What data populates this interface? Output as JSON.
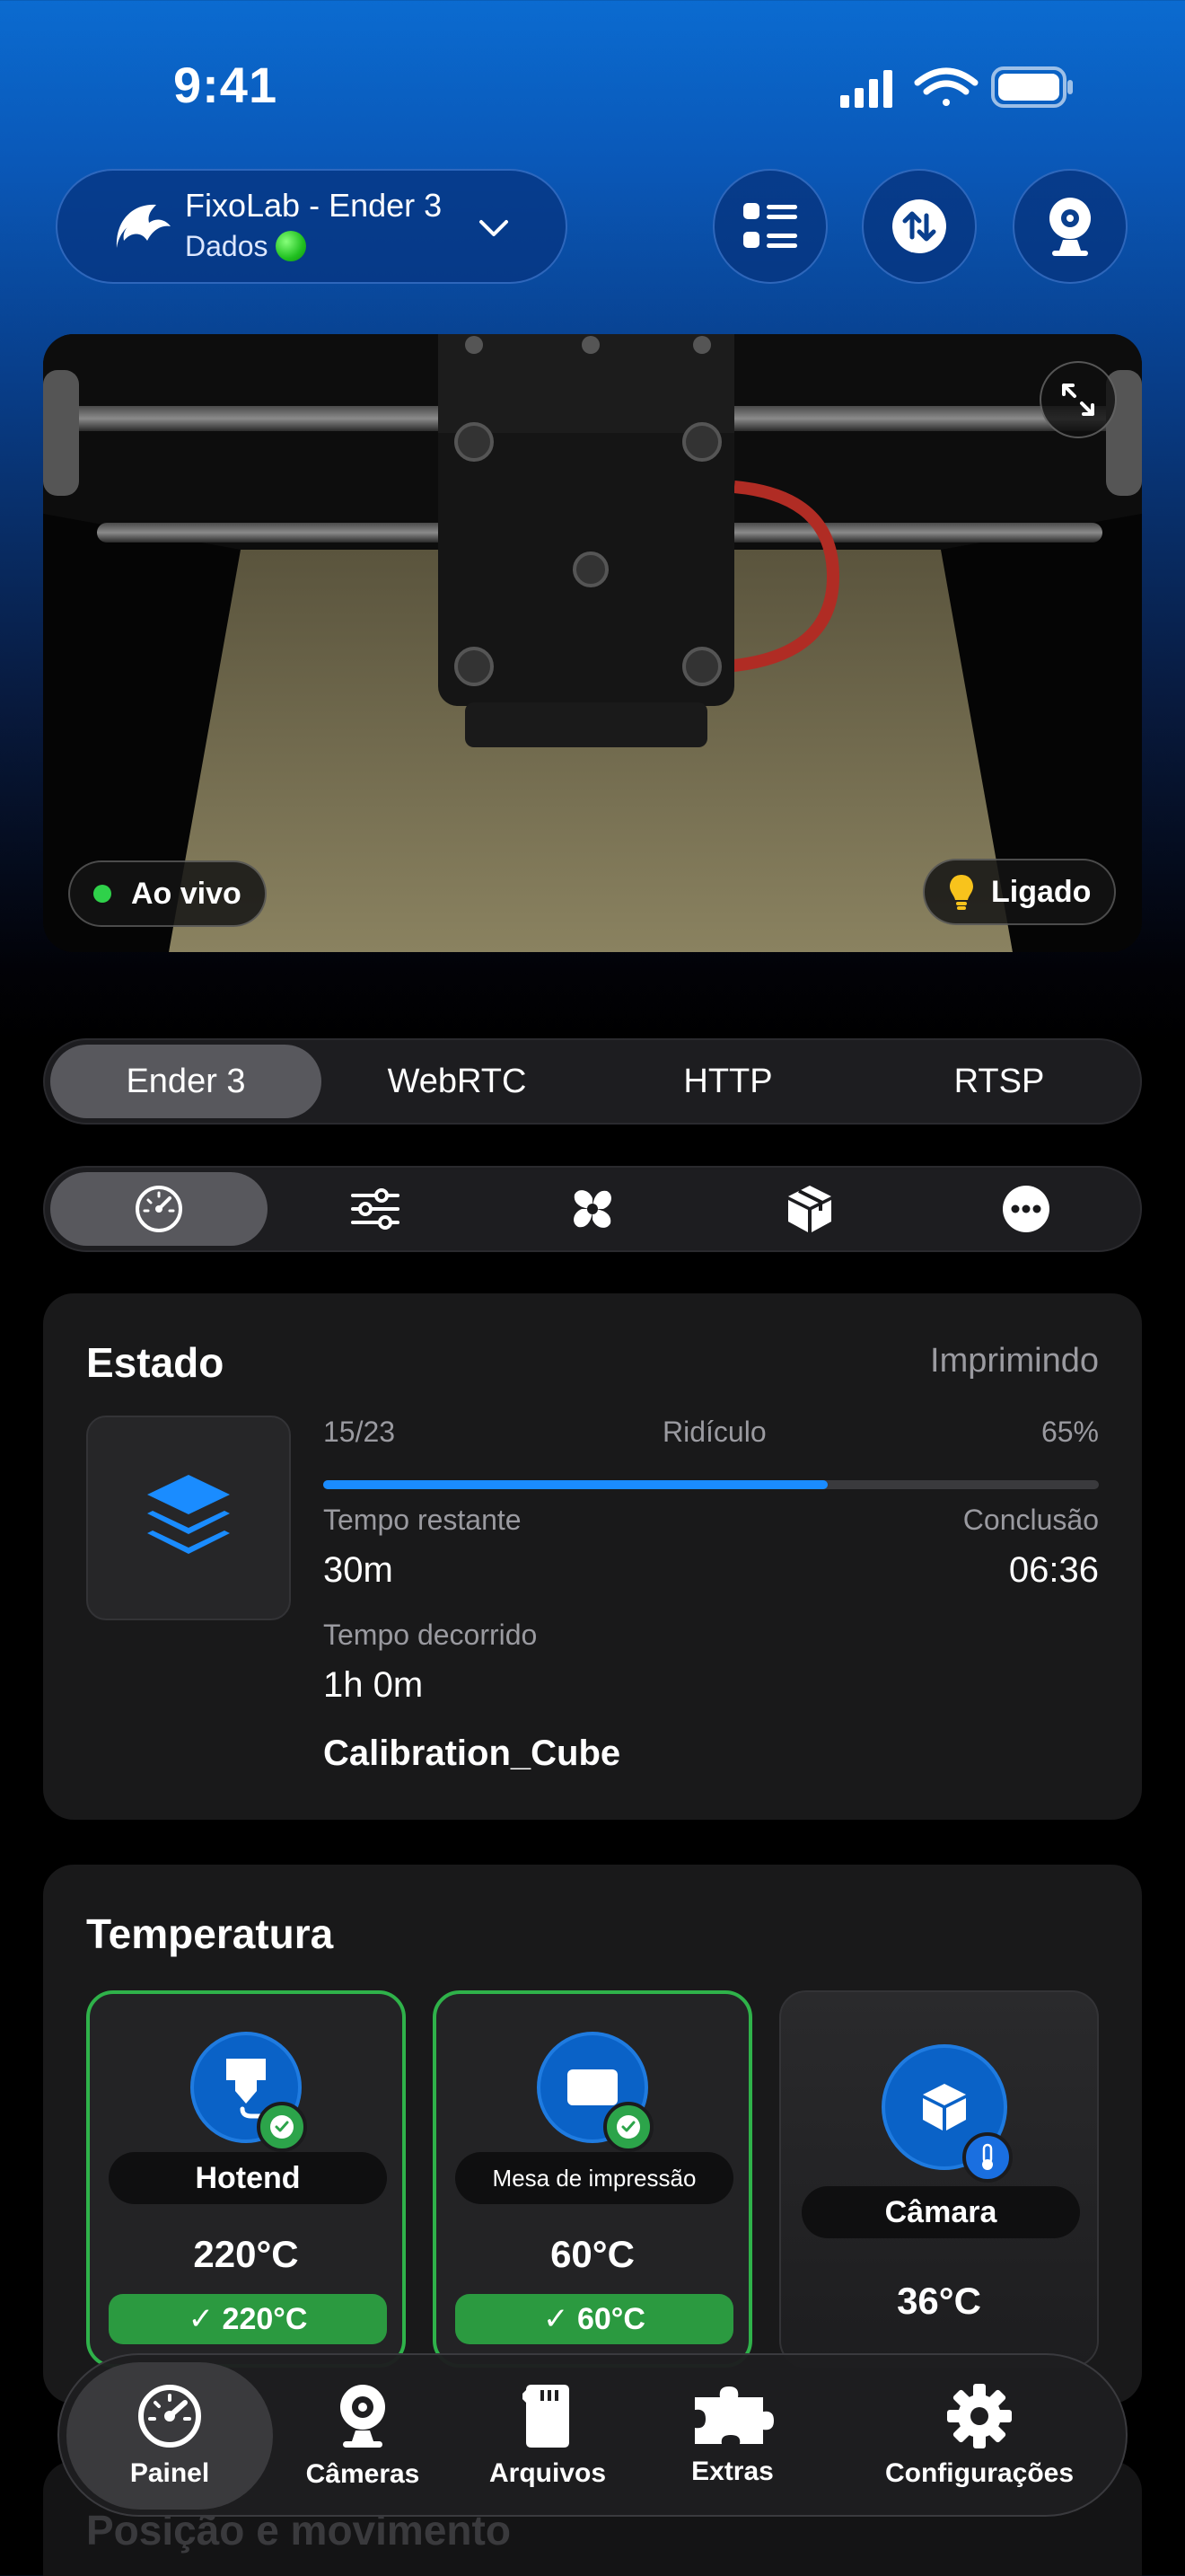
{
  "status_bar": {
    "time": "9:41"
  },
  "header": {
    "printer_name": "FixoLab - Ender 3",
    "printer_status": "Dados",
    "icons": [
      "printer-logo-icon",
      "chevron-down-icon",
      "list-icon",
      "swap-icon",
      "webcam-icon"
    ]
  },
  "camera": {
    "live_label": "Ao vivo",
    "light_label": "Ligado"
  },
  "camera_tabs": [
    "Ender 3",
    "WebRTC",
    "HTTP",
    "RTSP"
  ],
  "section_tabs": [
    "gauge-icon",
    "sliders-icon",
    "fan-icon",
    "cube-icon",
    "more-icon"
  ],
  "status_card": {
    "title": "Estado",
    "state": "Imprimindo",
    "layer": "15/23",
    "quality": "Ridículo",
    "percent_label": "65%",
    "progress": 0.65,
    "remaining_label": "Tempo restante",
    "remaining_value": "30m",
    "eta_label": "Conclusão",
    "eta_value": "06:36",
    "elapsed_label": "Tempo decorrido",
    "elapsed_value": "1h 0m",
    "file_name": "Calibration_Cube"
  },
  "temperature": {
    "title": "Temperatura",
    "tiles": [
      {
        "label": "Hotend",
        "temp": "220°C",
        "target": "✓ 220°C"
      },
      {
        "label": "Mesa de impressão",
        "temp": "60°C",
        "target": "✓ 60°C"
      },
      {
        "label": "Câmara",
        "temp": "36°C"
      }
    ]
  },
  "next_section_title": "Posição e movimento",
  "tabbar": {
    "items": [
      "Painel",
      "Câmeras",
      "Arquivos",
      "Extras",
      "Configurações"
    ]
  },
  "colors": {
    "accent": "#1a8cff",
    "success": "#2fb24a",
    "card": "#19191a"
  }
}
